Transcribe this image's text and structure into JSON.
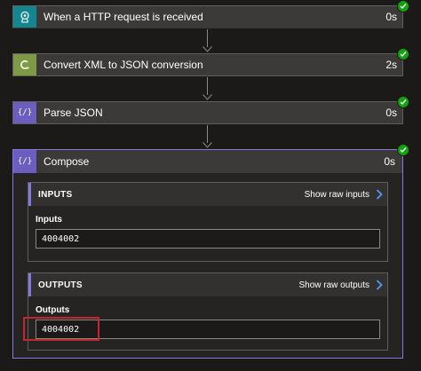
{
  "steps": [
    {
      "title": "When a HTTP request is received",
      "duration": "0s",
      "icon": "http-request-icon",
      "color": "#128790"
    },
    {
      "title": "Convert XML to JSON conversion",
      "duration": "2s",
      "icon": "convert-icon",
      "color": "#7f9a44"
    },
    {
      "title": "Parse JSON",
      "duration": "0s",
      "icon": "braces-icon",
      "color": "#6c5ec1"
    }
  ],
  "compose": {
    "title": "Compose",
    "duration": "0s",
    "icon": "braces-icon",
    "inputs": {
      "section_title": "INPUTS",
      "raw_link": "Show raw inputs",
      "field_label": "Inputs",
      "field_value": "4004002"
    },
    "outputs": {
      "section_title": "OUTPUTS",
      "raw_link": "Show raw outputs",
      "field_label": "Outputs",
      "field_value": "4004002"
    }
  },
  "colors": {
    "success": "#13a10e",
    "accent": "#8378de",
    "highlight": "#c4262e"
  }
}
